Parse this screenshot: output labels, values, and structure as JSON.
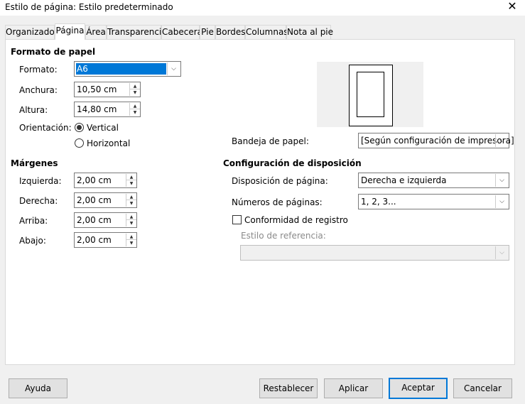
{
  "window": {
    "title": "Estilo de página: Estilo predeterminado",
    "close_glyph": "✕"
  },
  "tabs": [
    "Organizador",
    "Página",
    "Área",
    "Transparencia",
    "Cabecera",
    "Pie",
    "Bordes",
    "Columnas",
    "Nota al pie"
  ],
  "active_tab": "Página",
  "paper": {
    "section_title": "Formato de papel",
    "format_label": "Formato:",
    "format_value": "A6",
    "width_label": "Anchura:",
    "width_value": "10,50 cm",
    "height_label": "Altura:",
    "height_value": "14,80 cm",
    "orientation_label": "Orientación:",
    "orientation_options": [
      "Vertical",
      "Horizontal"
    ],
    "orientation_selected": "Vertical",
    "tray_label": "Bandeja de papel:",
    "tray_value": "[Según configuración de impresora]"
  },
  "margins": {
    "section_title": "Márgenes",
    "left_label": "Izquierda:",
    "left_value": "2,00 cm",
    "right_label": "Derecha:",
    "right_value": "2,00 cm",
    "top_label": "Arriba:",
    "top_value": "2,00 cm",
    "bottom_label": "Abajo:",
    "bottom_value": "2,00 cm"
  },
  "layout": {
    "section_title": "Configuración de disposición",
    "page_layout_label": "Disposición de página:",
    "page_layout_value": "Derecha e izquierda",
    "page_numbers_label": "Números de páginas:",
    "page_numbers_value": "1, 2, 3...",
    "register_label": "Conformidad de registro",
    "register_checked": false,
    "reference_style_label": "Estilo de referencia:",
    "reference_style_value": ""
  },
  "buttons": {
    "help": "Ayuda",
    "reset": "Restablecer",
    "apply": "Aplicar",
    "ok": "Aceptar",
    "cancel": "Cancelar"
  },
  "icons": {
    "spin_up": "▲",
    "spin_down": "▼",
    "dropdown": "⌵"
  },
  "colors": {
    "accent": "#0078d7"
  }
}
